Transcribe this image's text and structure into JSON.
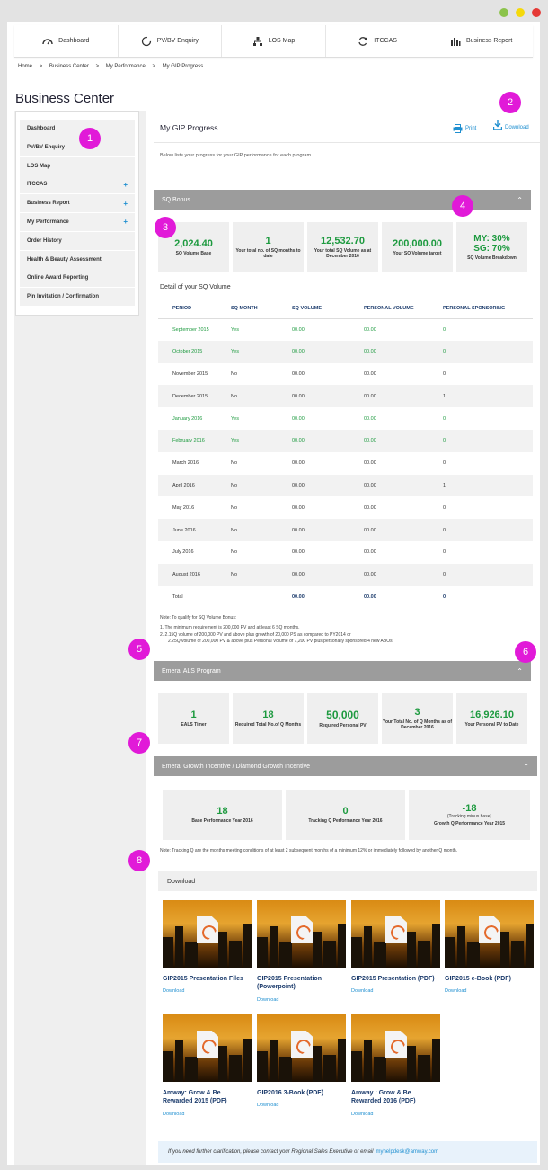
{
  "window_dots": [
    "#8bc34a",
    "#f5d90a",
    "#e53935"
  ],
  "topnav": [
    {
      "label": "Dashboard",
      "icon": "dashboard-icon"
    },
    {
      "label": "PV/BV Enquiry",
      "icon": "circle-icon"
    },
    {
      "label": "LOS Map",
      "icon": "hierarchy-icon"
    },
    {
      "label": "ITCCAS",
      "icon": "refresh-icon"
    },
    {
      "label": "Business Report",
      "icon": "bar-chart-icon"
    }
  ],
  "breadcrumb": [
    "Home",
    ">",
    "Business Center",
    ">",
    "My Performance",
    ">",
    "My GIP Progress"
  ],
  "section_title": "Business Center",
  "sidebar": [
    {
      "label": "Dashboard",
      "plus": ""
    },
    {
      "label": "PV/BV Enquiry",
      "plus": ""
    },
    {
      "label": "LOS Map",
      "plus": ""
    },
    {
      "label": "ITCCAS",
      "plus": "+"
    },
    {
      "label": "Business Report",
      "plus": "+"
    },
    {
      "label": "My Performance",
      "plus": "+"
    },
    {
      "label": "Order History",
      "plus": ""
    },
    {
      "label": "Health & Beauty Assessment",
      "plus": ""
    },
    {
      "label": "Online Award Reporting",
      "plus": ""
    },
    {
      "label": "Pin Invitation / Confirmation",
      "plus": ""
    }
  ],
  "main": {
    "title": "My GIP Progress",
    "print": "Print",
    "download": "Download",
    "intro": "Below lists your progress for your GIP performance for each program.",
    "sq_bar": "SQ Bonus",
    "sq_cards": [
      {
        "v": "2,024.40",
        "l": "SQ Volume Base"
      },
      {
        "v": "1",
        "l": "Your total no. of SQ months to date"
      },
      {
        "v": "12,532.70",
        "l": "Your total SQ Volume as at December 2016"
      },
      {
        "v": "200,000.00",
        "l": "Your SQ Volume target"
      },
      {
        "v": "MY: 30%",
        "v2": "SG: 70%",
        "l": "SQ Volume Breakdown"
      }
    ],
    "detail_title": "Detail of your SQ Volume",
    "table_headers": [
      "PERIOD",
      "SQ MONTH",
      "SQ VOLUME",
      "PERSONAL VOLUME",
      "PERSONAL SPONSORING"
    ],
    "table_rows": [
      [
        "September 2015",
        "Yes",
        "00.00",
        "00.00",
        "0"
      ],
      [
        "October 2015",
        "Yes",
        "00.00",
        "00.00",
        "0"
      ],
      [
        "November 2015",
        "No",
        "00.00",
        "00.00",
        "0"
      ],
      [
        "December 2015",
        "No",
        "00.00",
        "00.00",
        "1"
      ],
      [
        "January 2016",
        "Yes",
        "00.00",
        "00.00",
        "0"
      ],
      [
        "February 2016",
        "Yes",
        "00.00",
        "00.00",
        "0"
      ],
      [
        "March 2016",
        "No",
        "00.00",
        "00.00",
        "0"
      ],
      [
        "April 2016",
        "No",
        "00.00",
        "00.00",
        "1"
      ],
      [
        "May 2016",
        "No",
        "00.00",
        "00.00",
        "0"
      ],
      [
        "June 2016",
        "No",
        "00.00",
        "00.00",
        "0"
      ],
      [
        "July 2016",
        "No",
        "00.00",
        "00.00",
        "0"
      ],
      [
        "August 2016",
        "No",
        "00.00",
        "00.00",
        "0"
      ],
      [
        "Total",
        "",
        "00.00",
        "00.00",
        "0"
      ]
    ],
    "note_lines": [
      "Note: To qualify for SQ Volume Bonus:",
      "1. The minimum requirement is 200,000 PV and at least 6 SQ months.",
      "2. 2.15Q volume of 200,000 PV and above plus growth of 20,000 PS as compared to PY2014 or",
      "    2.25Q volume of 200,000 PV & above plus Personal Volume of 7,200 PV plus personally sponsored 4 new ABOs."
    ],
    "als_bar": "Emeral ALS Program",
    "als_cards": [
      {
        "v": "1",
        "l": "EALS Timer"
      },
      {
        "v": "18",
        "l": "Required Total No.of Q Months"
      },
      {
        "v": "50,000",
        "l": "Required Personal PV"
      },
      {
        "v": "3",
        "l": "Your Total No. of Q Months as of December 2016"
      },
      {
        "v": "16,926.10",
        "l": "Your Personal PV to Date"
      }
    ],
    "growth_bar": "Emeral Growth Incentive / Diamond Growth Incentive",
    "growth_cards": [
      {
        "v": "18",
        "pre": "",
        "l": "Base Performance Year 2016"
      },
      {
        "v": "0",
        "pre": "",
        "l": "Tracking Q Performance Year 2016"
      },
      {
        "v": "-18",
        "pre": "(Tracking minus base)",
        "l": "Growth Q Performance Year 2015"
      }
    ],
    "growth_note": "Note: Tracking Q are the months meeting conditions of at least 2 subsequent months of a minimum 12% or immediately followed by another Q month.",
    "download_title": "Download",
    "downloads": [
      {
        "title": "GIP2015 Presentation Files",
        "link": "Download"
      },
      {
        "title": "GIP2015 Presentation (Powerpoint)",
        "link": "Download"
      },
      {
        "title": "GIP2015 Presentation (PDF)",
        "link": "Download"
      },
      {
        "title": "GIP2015 e-Book (PDF)",
        "link": "Download"
      },
      {
        "title": "Amway: Grow & Be Rewarded 2015 (PDF)",
        "link": "Download"
      },
      {
        "title": "GIP2016 3-Book (PDF)",
        "link": "Download"
      },
      {
        "title": "Amway : Grow & Be Rewarded 2016 (PDF)",
        "link": "Download"
      }
    ],
    "help_text": "If you need further clarification, please contact your Regional Sales Executive or email",
    "help_email": "myhelpdesk@amway.com"
  },
  "badges": [
    "1",
    "2",
    "3",
    "4",
    "5",
    "6",
    "7",
    "8"
  ]
}
